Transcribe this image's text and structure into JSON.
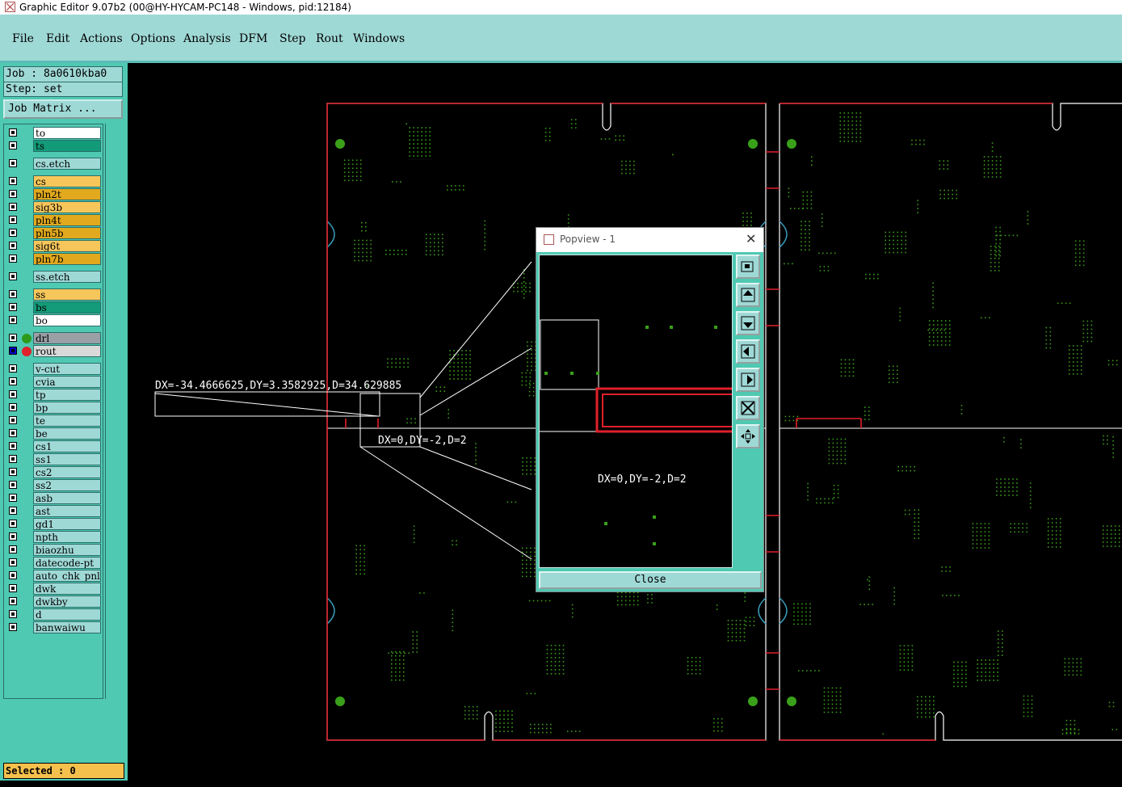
{
  "window": {
    "title": "Graphic Editor 9.07b2 (00@HY-HYCAM-PC148 - Windows, pid:12184)"
  },
  "menu": [
    "File",
    "Edit",
    "Actions",
    "Options",
    "Analysis",
    "DFM",
    "Step",
    "Rout",
    "Windows"
  ],
  "job": {
    "job_line": "Job : 8a0610kba0",
    "step_line": "Step: set"
  },
  "job_matrix_label": "Job Matrix ...",
  "layers": [
    {
      "name": "to",
      "color": "#ffffff"
    },
    {
      "name": "ts",
      "color": "#139a78"
    },
    {
      "name": "cs.etch",
      "color": "#9fd9d6"
    },
    {
      "name": "cs",
      "color": "#f7c65a"
    },
    {
      "name": "pln2t",
      "color": "#e2a91e"
    },
    {
      "name": "sig3b",
      "color": "#f7c65a"
    },
    {
      "name": "pln4t",
      "color": "#e2a91e"
    },
    {
      "name": "pln5b",
      "color": "#e2a91e"
    },
    {
      "name": "sig6t",
      "color": "#f7c65a"
    },
    {
      "name": "pln7b",
      "color": "#e2a91e"
    },
    {
      "name": "ss.etch",
      "color": "#9fd9d6"
    },
    {
      "name": "ss",
      "color": "#f7c65a"
    },
    {
      "name": "bs",
      "color": "#139a78"
    },
    {
      "name": "bo",
      "color": "#ffffff"
    },
    {
      "name": "drl",
      "color": "#9aa0a6"
    },
    {
      "name": "rout",
      "color": "#d9d9d9"
    },
    {
      "name": "v-cut",
      "color": "#9fd9d6"
    },
    {
      "name": "cvia",
      "color": "#9fd9d6"
    },
    {
      "name": "tp",
      "color": "#9fd9d6"
    },
    {
      "name": "bp",
      "color": "#9fd9d6"
    },
    {
      "name": "te",
      "color": "#9fd9d6"
    },
    {
      "name": "be",
      "color": "#9fd9d6"
    },
    {
      "name": "cs1",
      "color": "#9fd9d6"
    },
    {
      "name": "ss1",
      "color": "#9fd9d6"
    },
    {
      "name": "cs2",
      "color": "#9fd9d6"
    },
    {
      "name": "ss2",
      "color": "#9fd9d6"
    },
    {
      "name": "asb",
      "color": "#9fd9d6"
    },
    {
      "name": "ast",
      "color": "#9fd9d6"
    },
    {
      "name": "gd1",
      "color": "#9fd9d6"
    },
    {
      "name": "npth",
      "color": "#9fd9d6"
    },
    {
      "name": "biaozhu",
      "color": "#9fd9d6"
    },
    {
      "name": "datecode-pt",
      "color": "#9fd9d6"
    },
    {
      "name": "auto_chk_pnl",
      "color": "#9fd9d6"
    },
    {
      "name": "dwk",
      "color": "#9fd9d6"
    },
    {
      "name": "dwkby",
      "color": "#9fd9d6"
    },
    {
      "name": "d",
      "color": "#9fd9d6"
    },
    {
      "name": "banwaiwu",
      "color": "#9fd9d6"
    }
  ],
  "selected_label": "Selected : 0",
  "measure": {
    "main": "DX=-34.4666625,DY=3.3582925,D=34.629885",
    "small": "DX=0,DY=-2,D=2"
  },
  "popview": {
    "title": "Popview - 1",
    "measure": "DX=0,DY=-2,D=2",
    "close_label": "Close",
    "buttons": [
      "zoom-home-icon",
      "pan-up-icon",
      "pan-down-icon",
      "pan-left-icon",
      "pan-right-icon",
      "zoom-fit-icon",
      "pan-all-icon"
    ]
  },
  "colors": {
    "panel": "#4fc9b2",
    "menu": "#9fd9d6",
    "board_outline": "#ffffff",
    "rout": "#e0202a",
    "pads": "#3a9a1a"
  }
}
